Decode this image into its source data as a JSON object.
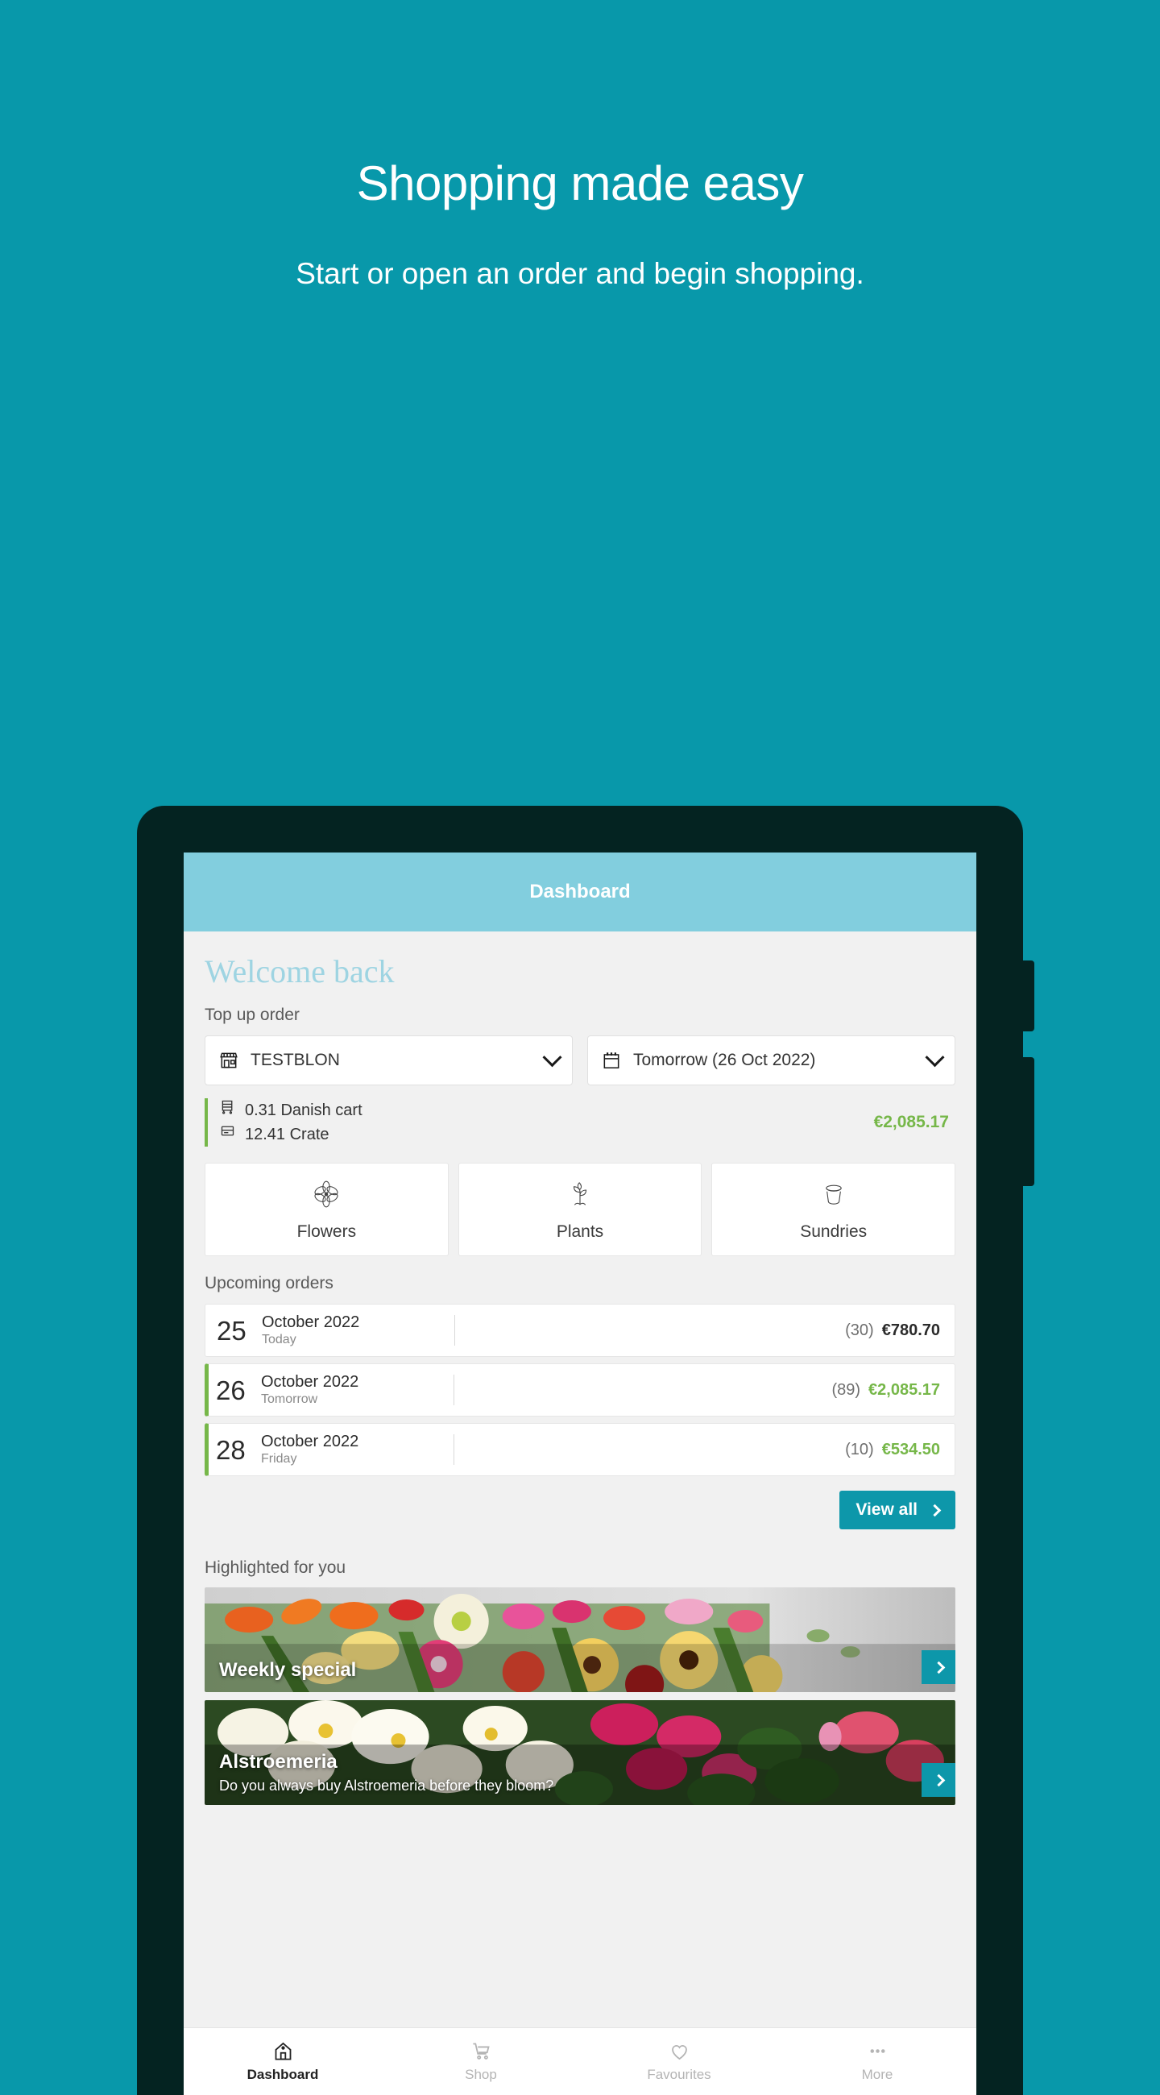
{
  "hero": {
    "title": "Shopping made easy",
    "subtitle": "Start or open an order and begin shopping."
  },
  "app": {
    "appbar": {
      "title": "Dashboard"
    },
    "welcome": "Welcome back",
    "topup": {
      "label": "Top up order",
      "location_value": "TESTBLON",
      "location_icon": "shop-icon",
      "date_value": "Tomorrow (26 Oct 2022)",
      "date_icon": "calendar-icon",
      "cart_line_1": "0.31 Danish cart",
      "cart_line_1_icon": "danish-cart-icon",
      "cart_line_2": "12.41 Crate",
      "cart_line_2_icon": "crate-icon",
      "total": "€2,085.17"
    },
    "categories": [
      {
        "label": "Flowers",
        "icon": "flower-icon"
      },
      {
        "label": "Plants",
        "icon": "seedling-icon"
      },
      {
        "label": "Sundries",
        "icon": "plant-pot-icon"
      }
    ],
    "upcoming": {
      "label": "Upcoming orders",
      "rows": [
        {
          "day": "25",
          "month": "October 2022",
          "relative": "Today",
          "count": "(30)",
          "amount": "€780.70",
          "accent": false,
          "amount_green": false
        },
        {
          "day": "26",
          "month": "October 2022",
          "relative": "Tomorrow",
          "count": "(89)",
          "amount": "€2,085.17",
          "accent": true,
          "amount_green": true
        },
        {
          "day": "28",
          "month": "October 2022",
          "relative": "Friday",
          "count": "(10)",
          "amount": "€534.50",
          "accent": true,
          "amount_green": true
        }
      ],
      "view_all": "View all"
    },
    "highlighted": {
      "label": "Highlighted for you",
      "banners": [
        {
          "title": "Weekly special",
          "subtitle": ""
        },
        {
          "title": "Alstroemeria",
          "subtitle": "Do you always buy Alstroemeria before they bloom?"
        }
      ]
    },
    "bottom_nav": [
      {
        "label": "Dashboard",
        "icon": "home-icon",
        "active": true
      },
      {
        "label": "Shop",
        "icon": "cart-icon",
        "active": false
      },
      {
        "label": "Favourites",
        "icon": "heart-icon",
        "active": false
      },
      {
        "label": "More",
        "icon": "ellipsis-icon",
        "active": false
      }
    ]
  },
  "colors": {
    "background_teal": "#0898AA",
    "appbar_blue": "#82CEDE",
    "accent_green": "#76b749",
    "button_teal": "#0D97AA",
    "device_frame": "#042321"
  }
}
